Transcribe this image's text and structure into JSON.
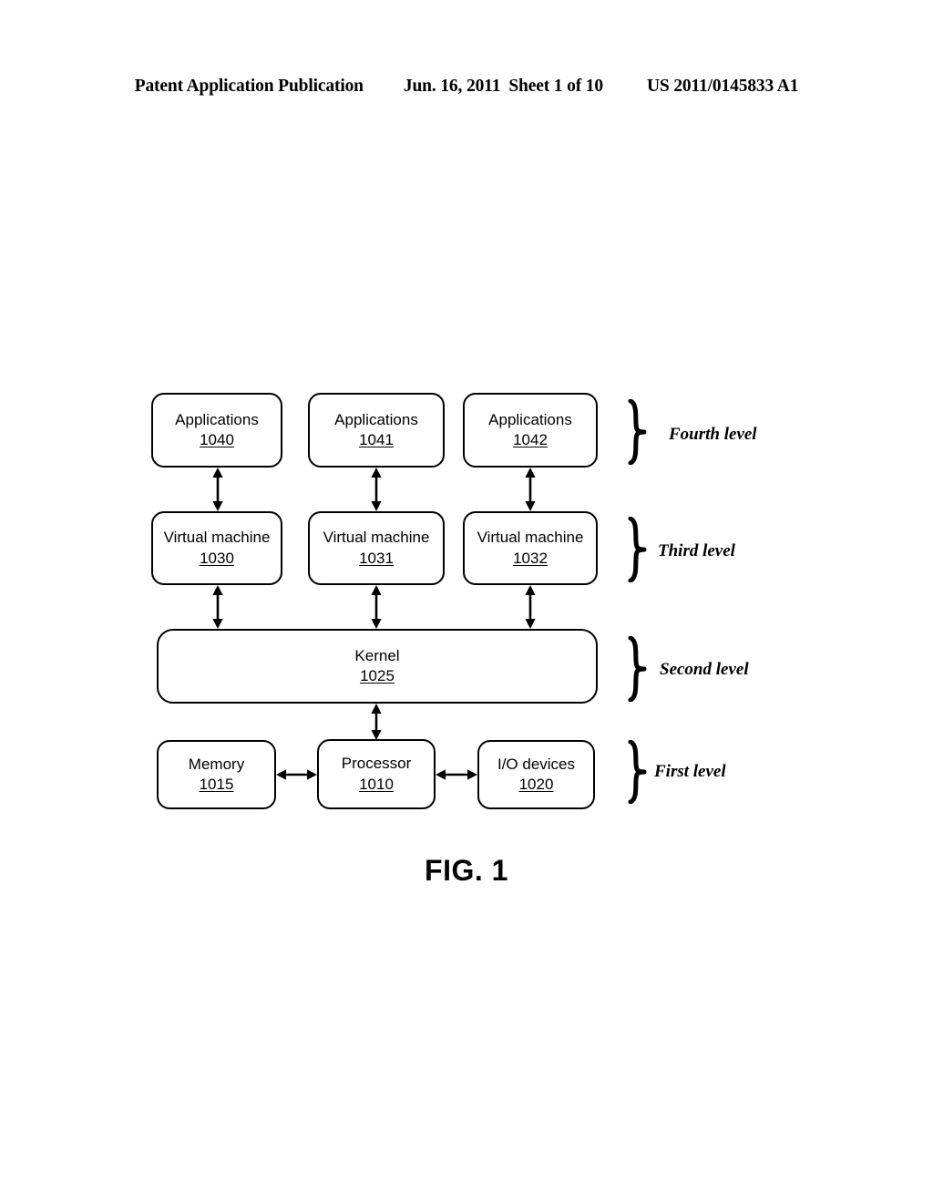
{
  "header": {
    "publication": "Patent Application Publication",
    "date": "Jun. 16, 2011",
    "sheet": "Sheet 1 of 10",
    "patent_number": "US 2011/0145833 A1"
  },
  "figure": {
    "caption": "FIG. 1"
  },
  "diagram": {
    "levels": [
      {
        "name": "Fourth level",
        "label": "Fourth level"
      },
      {
        "name": "Third level",
        "label": "Third level"
      },
      {
        "name": "Second level",
        "label": "Second level"
      },
      {
        "name": "First level",
        "label": "First level"
      }
    ],
    "applications": [
      {
        "label": "Applications",
        "ref": "1040"
      },
      {
        "label": "Applications",
        "ref": "1041"
      },
      {
        "label": "Applications",
        "ref": "1042"
      }
    ],
    "virtual_machines": [
      {
        "label": "Virtual machine",
        "ref": "1030"
      },
      {
        "label": "Virtual machine",
        "ref": "1031"
      },
      {
        "label": "Virtual machine",
        "ref": "1032"
      }
    ],
    "kernel": {
      "label": "Kernel",
      "ref": "1025"
    },
    "hardware": [
      {
        "label": "Memory",
        "ref": "1015"
      },
      {
        "label": "Processor",
        "ref": "1010"
      },
      {
        "label": "I/O devices",
        "ref": "1020"
      }
    ]
  }
}
